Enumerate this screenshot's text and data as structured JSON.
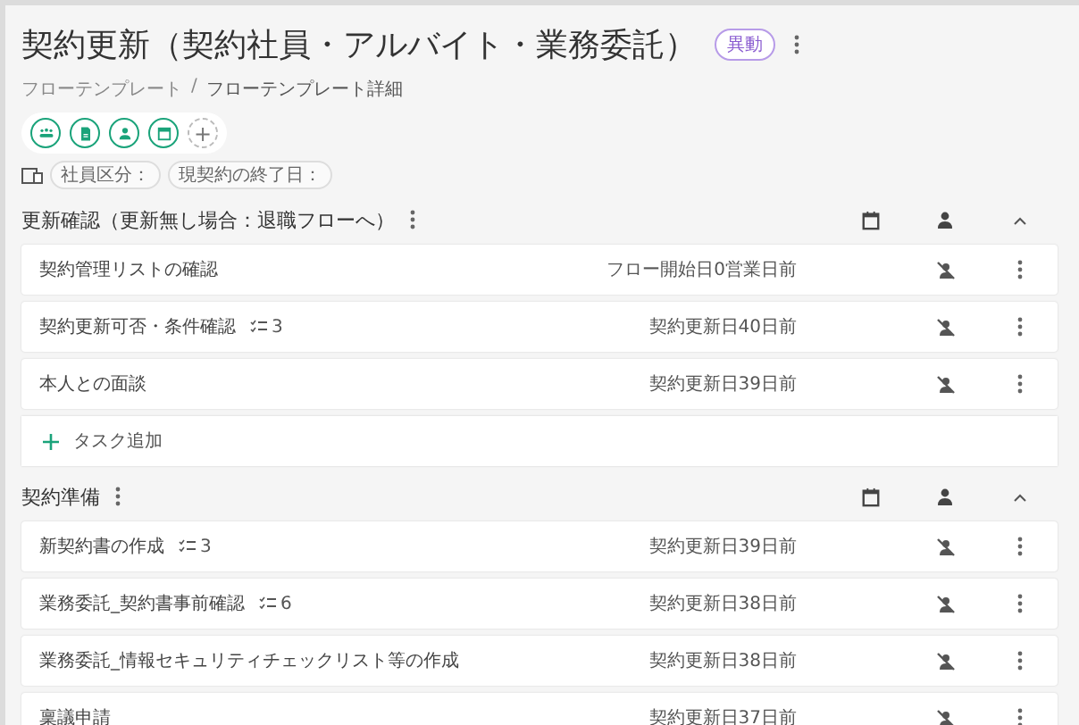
{
  "title": "契約更新（契約社員・アルバイト・業務委託）",
  "badge": "異動",
  "breadcrumb": [
    "フローテンプレート",
    "フローテンプレート詳細"
  ],
  "breadcrumb_separator": "/",
  "add_icon_label": "+",
  "attributes": [
    "社員区分：",
    "現契約の終了日："
  ],
  "sections": [
    {
      "title": "更新確認（更新無し場合：退職フローへ）",
      "expanded": true,
      "add_task": "タスク追加",
      "tasks": [
        {
          "name": "契約管理リストの確認",
          "due": "フロー開始日0営業日前"
        },
        {
          "name": "契約更新可否・条件確認",
          "checklist": "3",
          "due": "契約更新日40日前"
        },
        {
          "name": "本人との面談",
          "due": "契約更新日39日前"
        }
      ]
    },
    {
      "title": "契約準備",
      "expanded": true,
      "tasks": [
        {
          "name": "新契約書の作成",
          "checklist": "3",
          "due": "契約更新日39日前"
        },
        {
          "name": "業務委託_契約書事前確認",
          "checklist": "6",
          "due": "契約更新日38日前"
        },
        {
          "name": "業務委託_情報セキュリティチェックリスト等の作成",
          "due": "契約更新日38日前"
        },
        {
          "name": "稟議申請",
          "due": "契約更新日37日前"
        }
      ]
    }
  ]
}
